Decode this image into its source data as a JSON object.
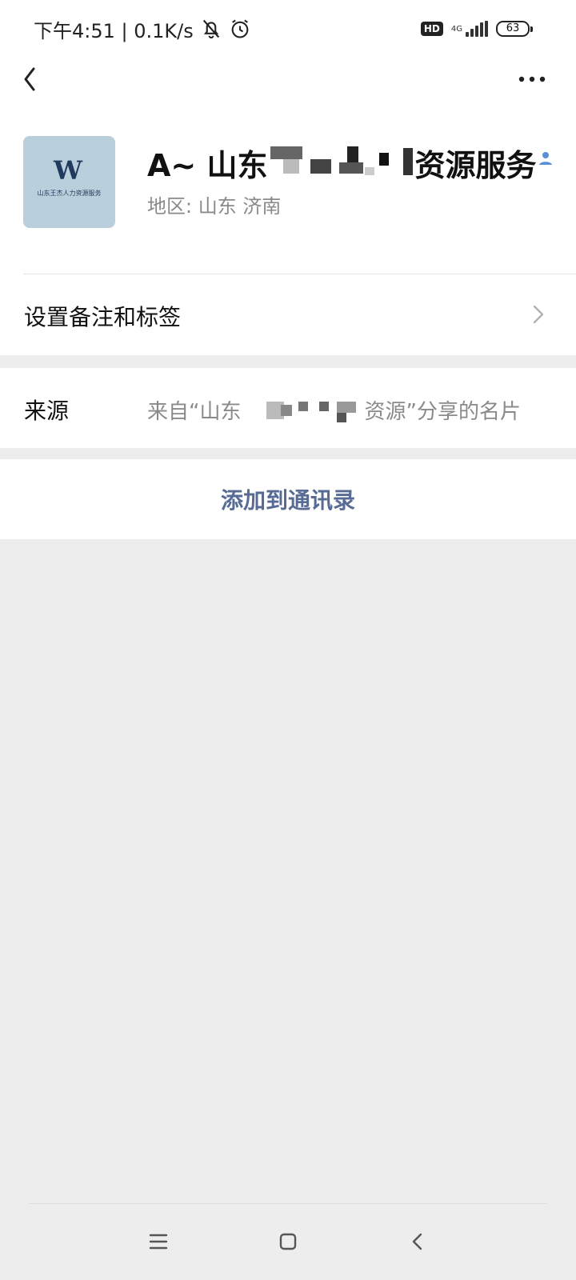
{
  "status_bar": {
    "time_speed": "下午4:51 | 0.1K/s",
    "hd_badge": "HD",
    "network": "4G",
    "battery": "63"
  },
  "profile": {
    "name_prefix": "A~ 山东",
    "name_suffix": "资源服务",
    "region": "地区:  山东  济南",
    "avatar_letter": "W",
    "avatar_caption": "山东王杰人力资源服务"
  },
  "rows": {
    "remark_label": "设置备注和标签",
    "source_label": "来源",
    "source_value_prefix": "来自“山东",
    "source_value_suffix": "资源”分享的名片"
  },
  "actions": {
    "add_label": "添加到通讯录"
  },
  "colors": {
    "link": "#576b95",
    "background": "#ededed",
    "secondary_text": "#8a8a8a"
  }
}
